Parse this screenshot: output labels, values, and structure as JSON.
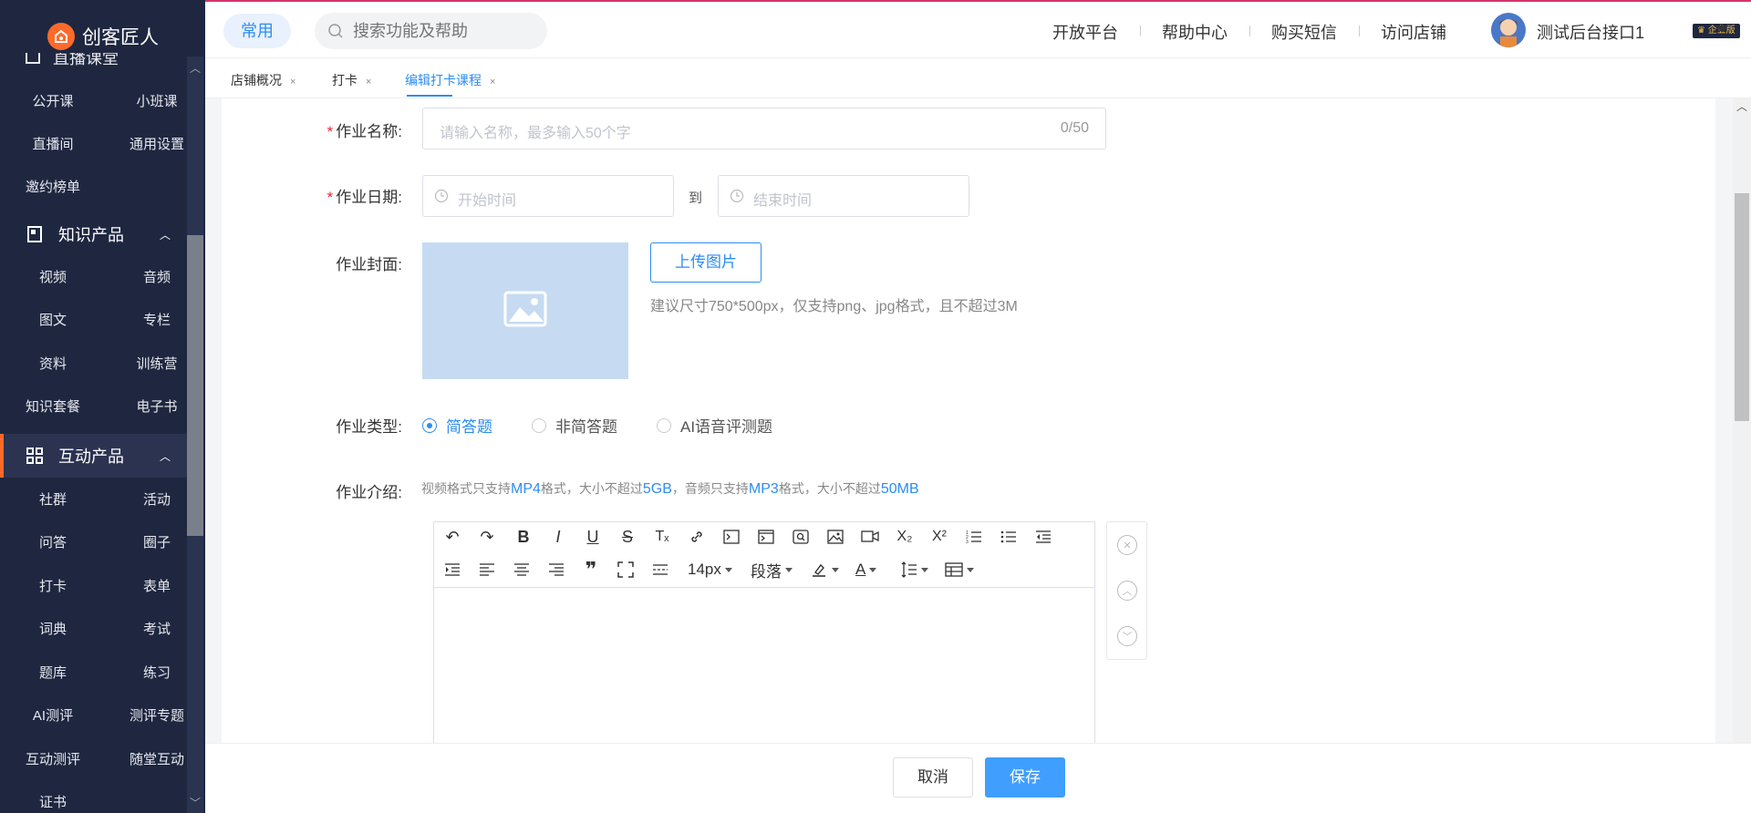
{
  "app": {
    "name": "创客匠人"
  },
  "header": {
    "chip": "常用",
    "search_placeholder": "搜索功能及帮助",
    "nav": [
      "开放平台",
      "帮助中心",
      "购买短信",
      "访问店铺"
    ],
    "user_name": "测试后台接口1",
    "user_badge": "企业版"
  },
  "sidebar": {
    "partial_section": "直播课堂",
    "group_live": [
      "公开课",
      "小班课",
      "直播间",
      "通用设置",
      "邀约榜单"
    ],
    "section_knowledge": "知识产品",
    "group_knowledge": [
      "视频",
      "音频",
      "图文",
      "专栏",
      "资料",
      "训练营",
      "知识套餐",
      "电子书"
    ],
    "section_interact": "互动产品",
    "group_interact": [
      "社群",
      "活动",
      "问答",
      "圈子",
      "打卡",
      "表单",
      "词典",
      "考试",
      "题库",
      "练习",
      "AI测评",
      "测评专题",
      "互动测评",
      "随堂互动",
      "证书"
    ]
  },
  "tabs": [
    {
      "label": "店铺概况"
    },
    {
      "label": "打卡"
    },
    {
      "label": "编辑打卡课程"
    }
  ],
  "tab_close": "×",
  "form": {
    "name_label": "作业名称:",
    "name_placeholder": "请输入名称，最多输入50个字",
    "name_counter": "0/50",
    "date_label": "作业日期:",
    "start_placeholder": "开始时间",
    "to_text": "到",
    "end_placeholder": "结束时间",
    "cover_label": "作业封面:",
    "upload_label": "上传图片",
    "cover_hint": "建议尺寸750*500px，仅支持png、jpg格式，且不超过3M",
    "type_label": "作业类型:",
    "type_options": [
      "简答题",
      "非简答题",
      "AI语音评测题"
    ],
    "intro_label": "作业介绍:",
    "intro_note": {
      "t1": "视频格式只支持",
      "v1": "MP4",
      "t2": "格式，大小不超过",
      "v2": "5GB",
      "t3": "，音频只支持",
      "v3": "MP3",
      "t4": "格式，大小不超过",
      "v4": "50MB"
    }
  },
  "editor": {
    "font_size": "14px",
    "paragraph": "段落",
    "quote_glyph": "❞",
    "undo_glyph": "↶",
    "redo_glyph": "↷",
    "bold_glyph": "B",
    "italic_glyph": "I",
    "underline_glyph": "U",
    "strike_glyph": "S",
    "clear_glyph": "Tₓ",
    "sub_glyph": "X₂",
    "sup_glyph": "X²",
    "color_glyph": "A"
  },
  "footer": {
    "cancel": "取消",
    "save": "保存"
  },
  "colors": {
    "accent": "#2d8cf0",
    "sidebar_bg": "#1f2740",
    "brand": "#ff6a2a",
    "save_bg": "#409eff"
  }
}
